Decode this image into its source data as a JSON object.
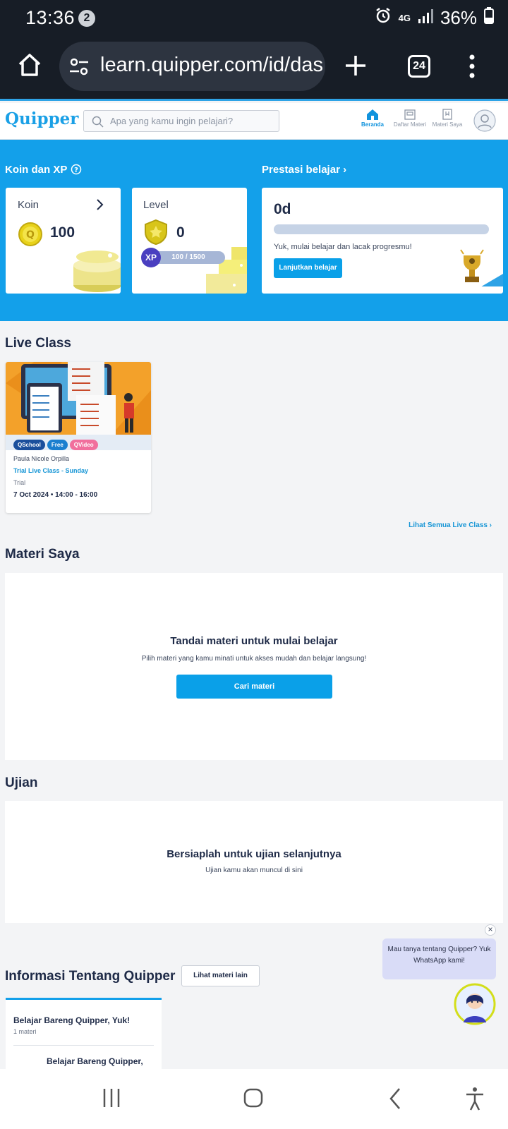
{
  "status": {
    "time": "13:36",
    "notifications": "2",
    "network": "4G",
    "battery": "36%"
  },
  "browser": {
    "url": "learn.quipper.com/id/das",
    "tab_count": "24"
  },
  "app": {
    "logo": "Quipper",
    "search_placeholder": "Apa yang kamu ingin pelajari?",
    "nav": [
      {
        "label": "Beranda",
        "icon": "home-icon"
      },
      {
        "label": "Daftar Materi",
        "icon": "catalog-icon"
      },
      {
        "label": "Materi Saya",
        "icon": "bookmark-book-icon"
      }
    ]
  },
  "hero": {
    "koin_xp_title": "Koin dan XP",
    "koin": {
      "label": "Koin",
      "value": "100"
    },
    "level": {
      "label": "Level",
      "value": "0",
      "xp_badge": "XP",
      "xp_text": "100 / 1500",
      "xp_progress": 0.0667
    },
    "prestasi": {
      "title": "Prestasi belajar",
      "value": "0d",
      "message": "Yuk, mulai belajar dan lacak progresmu!",
      "button": "Lanjutkan belajar"
    }
  },
  "live_class": {
    "title": "Live Class",
    "card": {
      "chips": [
        "QSchool",
        "Free",
        "QVideo"
      ],
      "teacher": "Paula Nicole Orpilla",
      "name": "Trial Live Class - Sunday",
      "type": "Trial",
      "schedule": "7 Oct 2024 • 14:00 - 16:00"
    },
    "see_all": "Lihat Semua Live Class"
  },
  "materi_saya": {
    "title": "Materi Saya",
    "heading": "Tandai materi untuk mulai belajar",
    "desc": "Pilih materi yang kamu minati untuk akses mudah dan belajar langsung!",
    "button": "Cari materi"
  },
  "ujian": {
    "title": "Ujian",
    "heading": "Bersiaplah untuk ujian selanjutnya",
    "desc": "Ujian kamu akan muncul di sini"
  },
  "informasi": {
    "title": "Informasi Tentang Quipper",
    "button": "Lihat materi lain",
    "card_title": "Belajar Bareng Quipper, Yuk!",
    "card_count": "1 materi",
    "item_title": "Belajar Bareng Quipper,"
  },
  "chat_bubble": {
    "text": "Mau tanya tentang Quipper? Yuk WhatsApp kami!"
  },
  "colors": {
    "brand_blue": "#13a0ea",
    "dark_navy": "#1e2a47",
    "button_blue": "#0aa0e8",
    "status_bg": "#171d26"
  }
}
